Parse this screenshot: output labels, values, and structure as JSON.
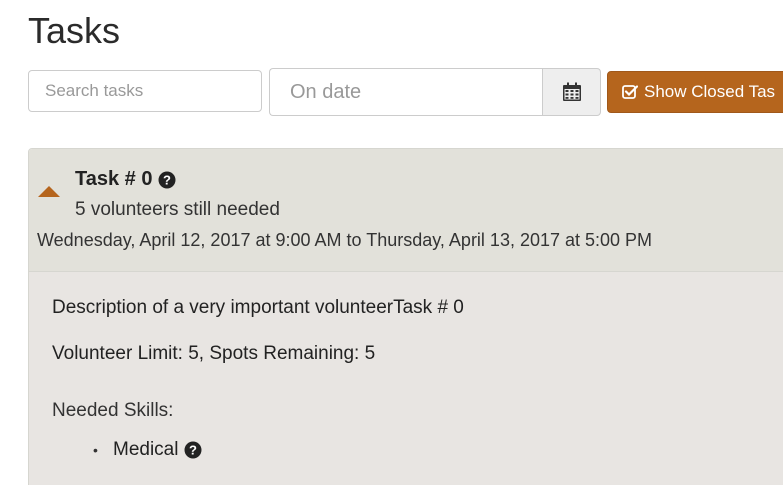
{
  "page": {
    "title": "Tasks"
  },
  "toolbar": {
    "search_placeholder": "Search tasks",
    "date_placeholder": "On date",
    "calendar_icon": "calendar-icon",
    "show_closed_label": "Show Closed Tas",
    "show_closed_icon": "check-square-icon"
  },
  "task": {
    "title": "Task # 0",
    "volunteers_needed": "5 volunteers still needed",
    "date_range": "Wednesday, April 12, 2017 at 9:00 AM to Thursday, April 13, 2017 at 5:00 PM",
    "description": "Description of a very important volunteerTask # 0",
    "limit": "Volunteer Limit: 5, Spots Remaining: 5",
    "skills_heading": "Needed Skills:",
    "skills": [
      {
        "name": "Medical"
      }
    ]
  },
  "colors": {
    "accent": "#b5651d",
    "header_bg": "#e2e1da",
    "body_bg": "#e8e5e2"
  }
}
